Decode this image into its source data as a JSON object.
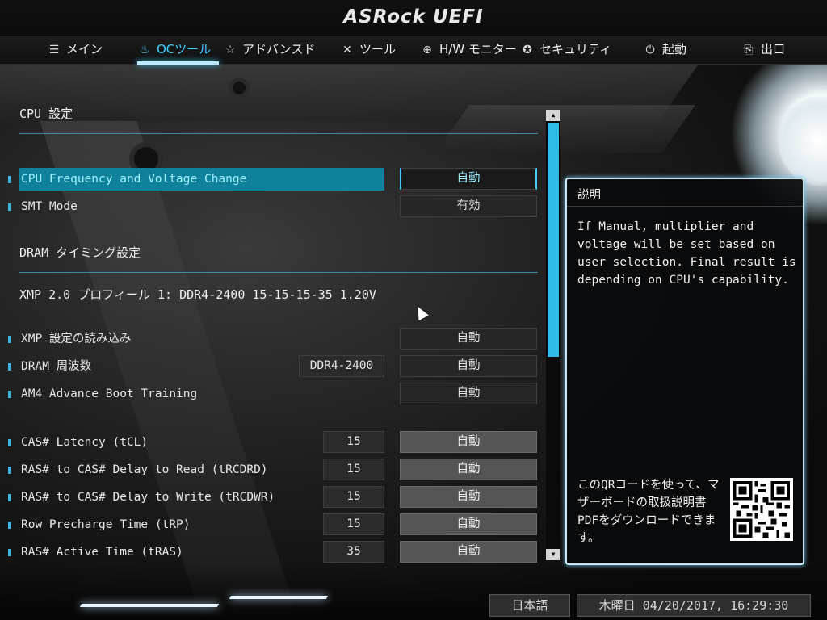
{
  "brand": "ASRock UEFI",
  "nav": [
    {
      "label": "メイン",
      "icon": "list-icon"
    },
    {
      "label": "OCツール",
      "icon": "flame-icon",
      "active": true
    },
    {
      "label": "アドバンスド",
      "icon": "star-icon"
    },
    {
      "label": "ツール",
      "icon": "tools-icon"
    },
    {
      "label": "H/W モニター",
      "icon": "monitor-icon"
    },
    {
      "label": "セキュリティ",
      "icon": "shield-icon"
    },
    {
      "label": "起動",
      "icon": "power-icon"
    },
    {
      "label": "出口",
      "icon": "exit-door-icon"
    }
  ],
  "sections": {
    "cpu": "CPU 設定",
    "dram": "DRAM タイミング設定"
  },
  "xmp_profile": "XMP 2.0 プロフィール 1: DDR4-2400 15-15-15-35 1.20V",
  "rows": {
    "cpu_freq": {
      "label": "CPU Frequency and Voltage Change",
      "value": "自動"
    },
    "smt": {
      "label": "SMT Mode",
      "value": "有効"
    },
    "xmp_load": {
      "label": "XMP 設定の読み込み",
      "value": "自動"
    },
    "dram_freq": {
      "label": "DRAM 周波数",
      "current": "DDR4-2400",
      "value": "自動"
    },
    "am4": {
      "label": "AM4 Advance Boot Training",
      "value": "自動"
    },
    "tcl": {
      "label": "CAS# Latency (tCL)",
      "current": "15",
      "value": "自動"
    },
    "trcdrd": {
      "label": "RAS# to CAS# Delay to Read  (tRCDRD)",
      "current": "15",
      "value": "自動"
    },
    "trcdwr": {
      "label": "RAS# to CAS# Delay to Write (tRCDWR)",
      "current": "15",
      "value": "自動"
    },
    "trp": {
      "label": "Row Precharge Time (tRP)",
      "current": "15",
      "value": "自動"
    },
    "tras": {
      "label": "RAS# Active Time (tRAS)",
      "current": "35",
      "value": "自動"
    }
  },
  "description": {
    "title": "説明",
    "text": "If Manual, multiplier and voltage will be set based on user selection. Final result is depending on CPU's capability.",
    "qr_text": "このQRコードを使って、マザーボードの取扱説明書PDFをダウンロードできます。"
  },
  "footer": {
    "language": "日本語",
    "datetime": "木曜日 04/20/2017, 16:29:30"
  },
  "colors": {
    "accent": "#3fd0ff",
    "selected_row": "#10819a"
  }
}
